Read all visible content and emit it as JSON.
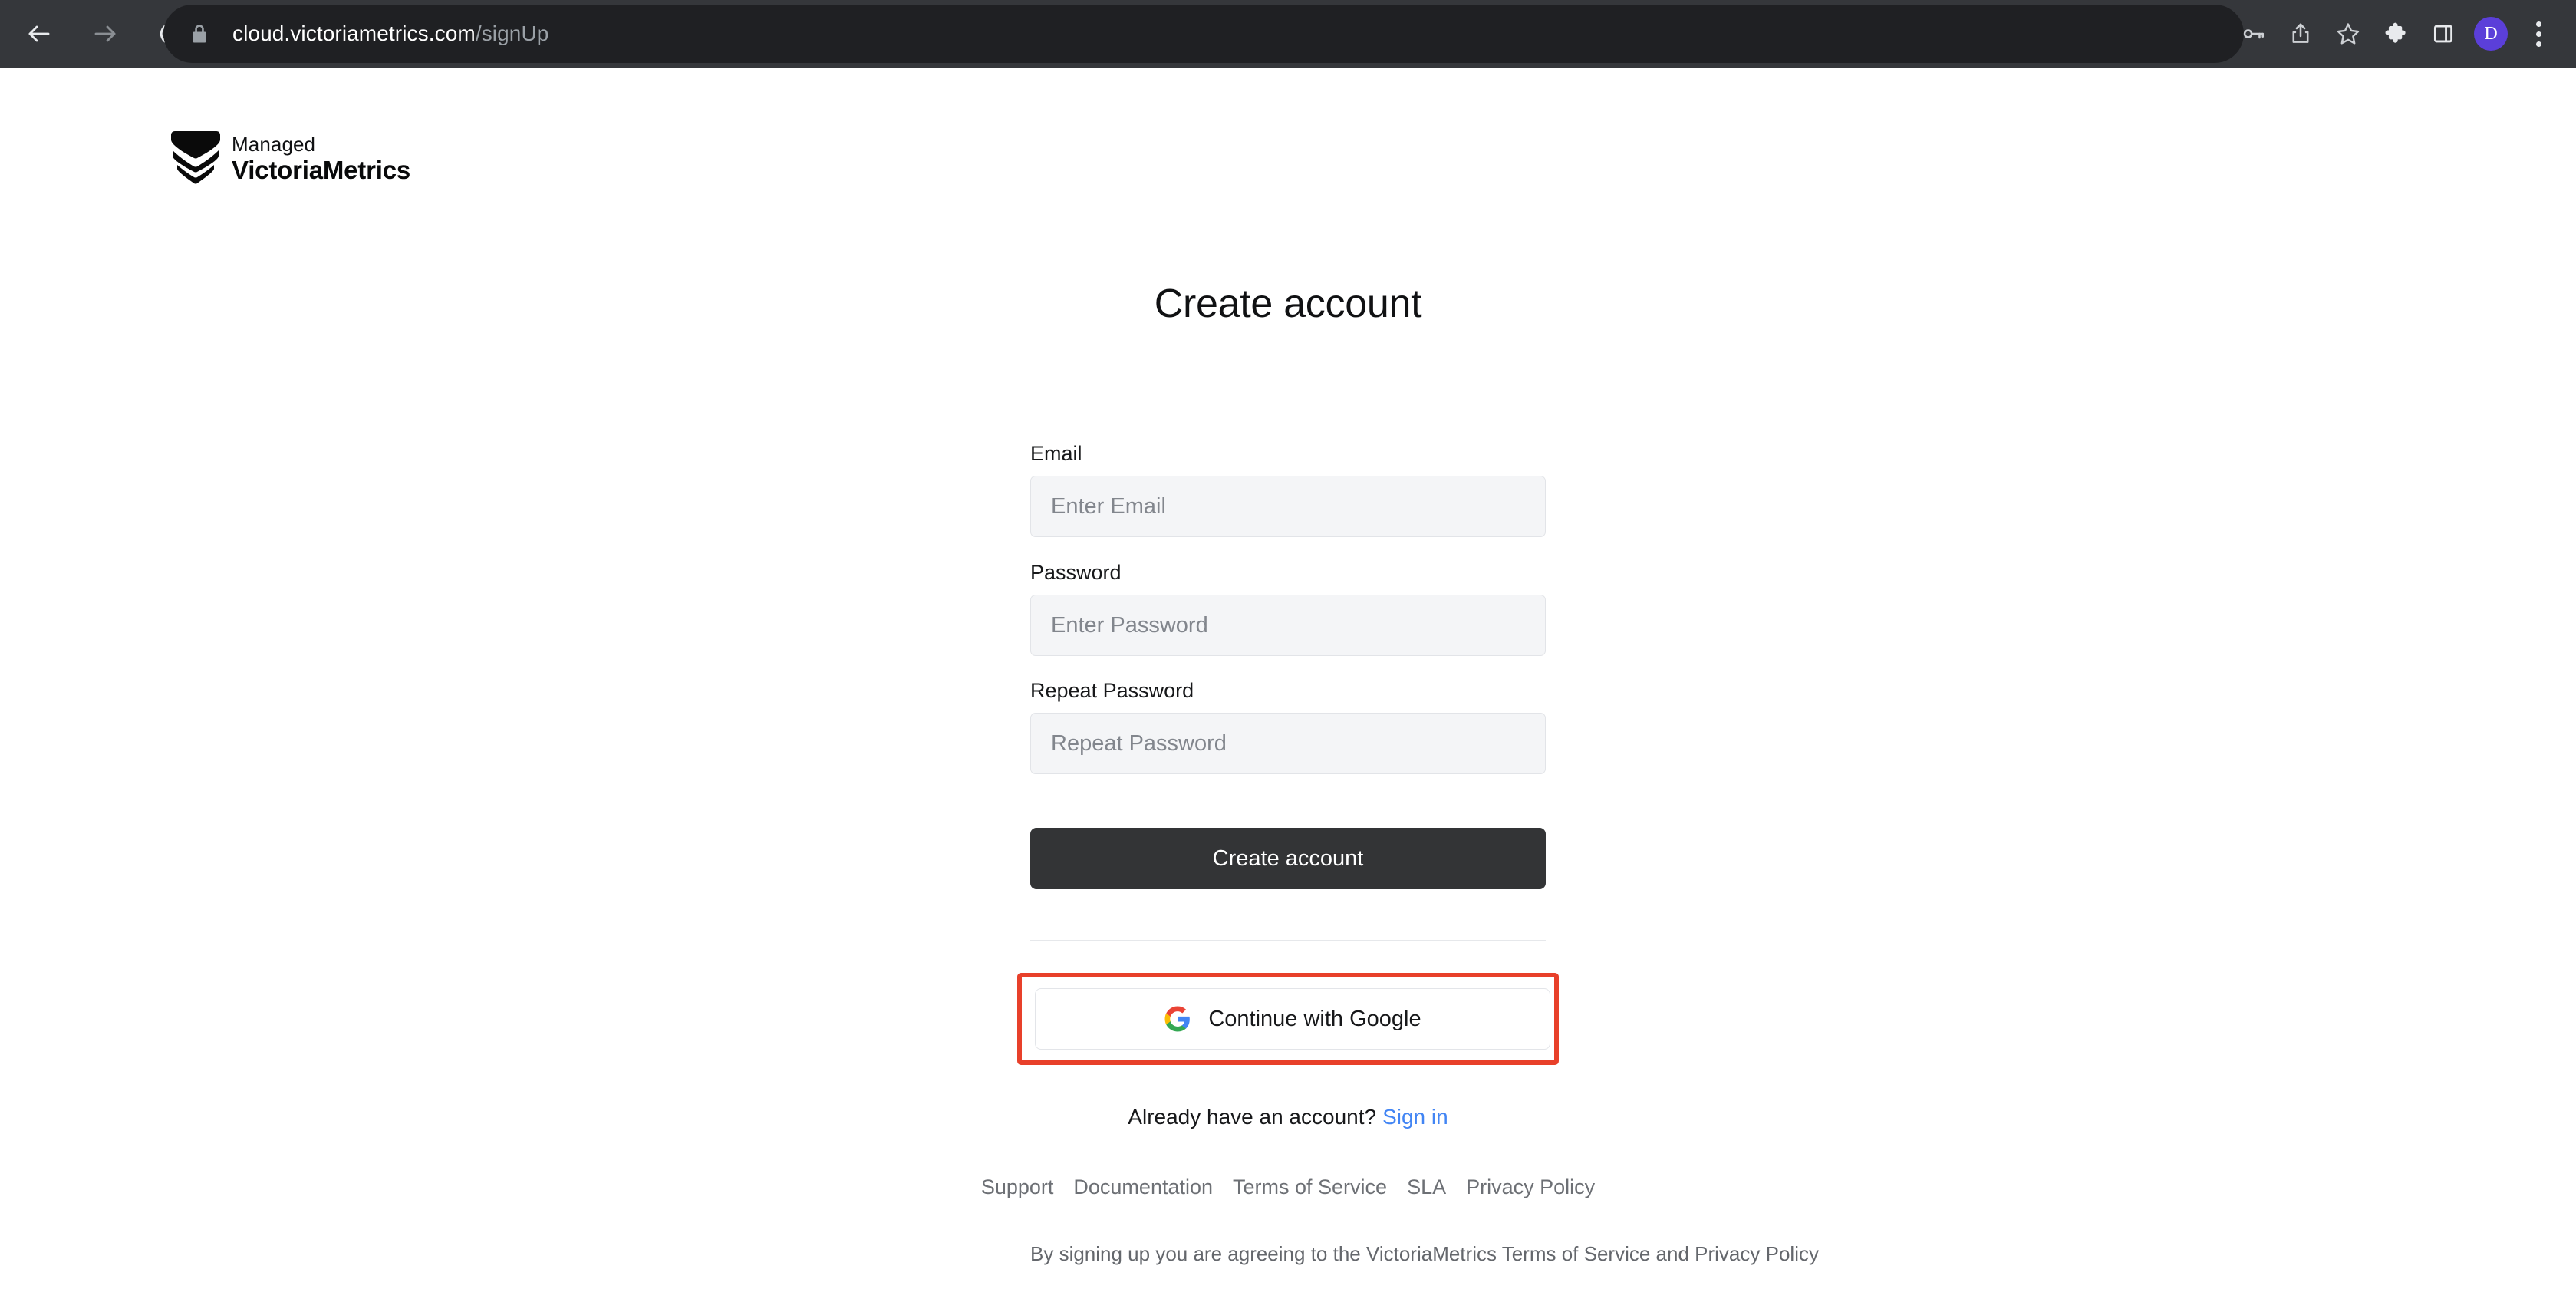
{
  "browser": {
    "back_label": "Back",
    "forward_label": "Forward",
    "reload_label": "Reload",
    "url_domain": "cloud.victoriametrics.com",
    "url_path": "/signUp",
    "lock_icon": "lock-icon",
    "actions": [
      {
        "name": "password-manager-icon",
        "label": "Password manager"
      },
      {
        "name": "share-icon",
        "label": "Share"
      },
      {
        "name": "bookmark-star-icon",
        "label": "Bookmark"
      },
      {
        "name": "extensions-puzzle-icon",
        "label": "Extensions"
      },
      {
        "name": "side-panel-icon",
        "label": "Side panel"
      }
    ],
    "profile_initial": "D",
    "menu_label": "Customize and control"
  },
  "brand": {
    "managed": "Managed",
    "name": "VictoriaMetrics",
    "mark": "chevron-shield-logo"
  },
  "form": {
    "title": "Create account",
    "email": {
      "label": "Email",
      "placeholder": "Enter Email",
      "value": ""
    },
    "password": {
      "label": "Password",
      "placeholder": "Enter Password",
      "value": ""
    },
    "repeat_password": {
      "label": "Repeat Password",
      "placeholder": "Repeat Password",
      "value": ""
    },
    "submit_label": "Create account",
    "google_label": "Continue with Google",
    "google_icon": "google-g-icon",
    "highlight_color": "#e8402a"
  },
  "signin": {
    "prompt": "Already have an account?",
    "link_label": "Sign in",
    "link_color": "#4285f4"
  },
  "footer": {
    "links": [
      {
        "label": "Support"
      },
      {
        "label": "Documentation"
      },
      {
        "label": "Terms of Service"
      },
      {
        "label": "SLA"
      },
      {
        "label": "Privacy Policy"
      }
    ],
    "legal": "By signing up you are agreeing to the VictoriaMetrics Terms of Service and Privacy Policy"
  }
}
